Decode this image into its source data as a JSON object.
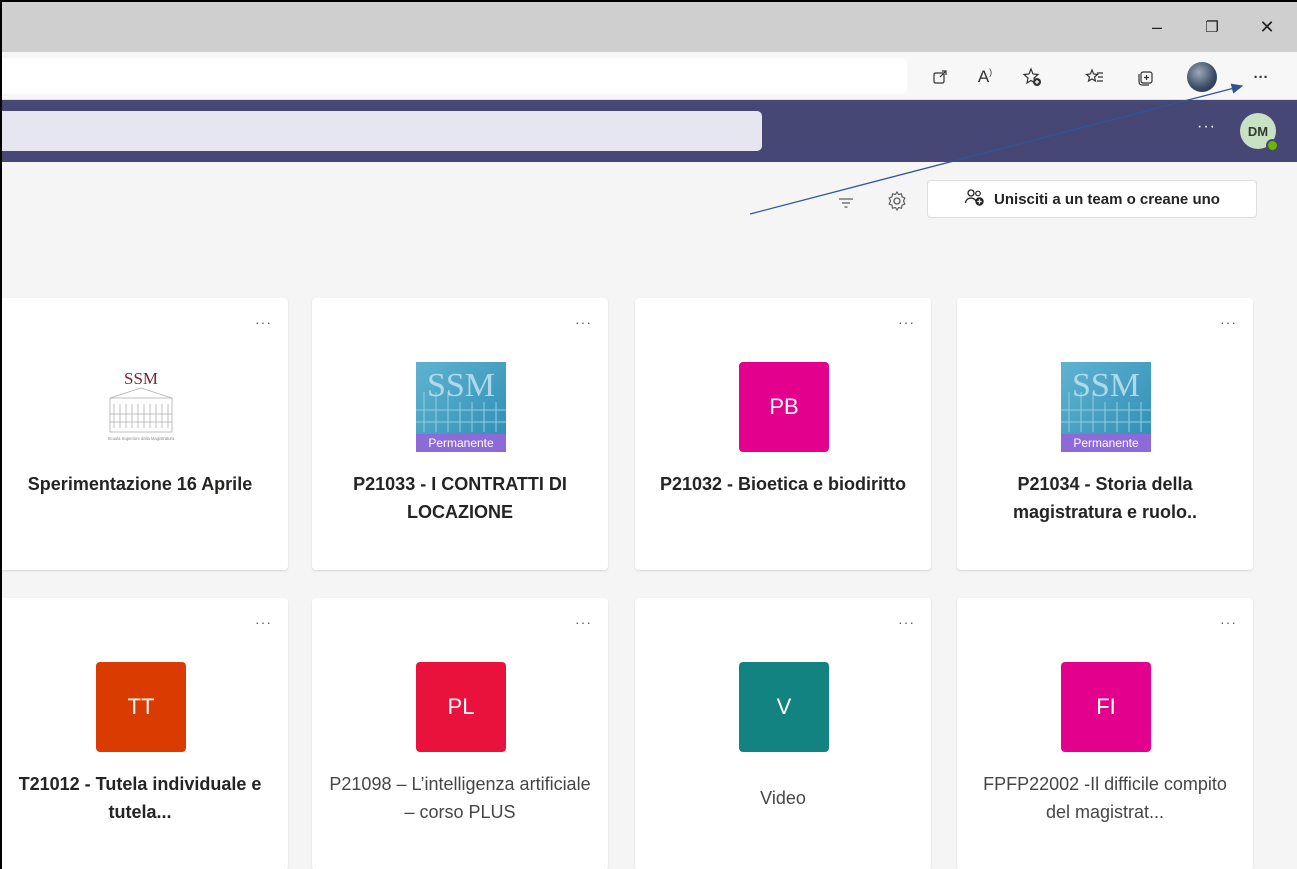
{
  "window": {
    "minimize": "–",
    "restore": "❐",
    "close": "✕"
  },
  "browser_toolbar": {
    "icons": [
      "open-external-icon",
      "read-aloud-icon",
      "add-favorite-icon",
      "favorites-icon",
      "collections-icon",
      "profile-avatar",
      "more-icon"
    ],
    "read_aloud_glyph": "A",
    "more_label": "···"
  },
  "teams_header": {
    "more_label": "···",
    "user_initials": "DM"
  },
  "toolbar": {
    "join_button_label": "Unisciti a un team o creane uno"
  },
  "cards": [
    {
      "title": "Sperimentazione 16 Aprile",
      "tile": "ssm-logo",
      "bold": true
    },
    {
      "title": "P21033 - I CONTRATTI DI LOCAZIONE",
      "tile": "ssm-permanente",
      "tile_caption": "Permanente",
      "bold": true
    },
    {
      "title": "P21032 - Bioetica e biodiritto",
      "tile_text": "PB",
      "tile_color": "#e3008c",
      "bold": true
    },
    {
      "title": "P21034 - Storia della magistratura e ruolo..",
      "tile": "ssm-permanente",
      "tile_caption": "Permanente",
      "bold": true
    },
    {
      "title": "T21012 - Tutela individuale e tutela...",
      "tile_text": "TT",
      "tile_color": "#da3b01",
      "bold": true
    },
    {
      "title": "P21098 – L’intelligenza artificiale – corso PLUS",
      "tile_text": "PL",
      "tile_color": "#e8123c",
      "bold": false
    },
    {
      "title": "Video",
      "tile_text": "V",
      "tile_color": "#138381",
      "bold": false
    },
    {
      "title": "FPFP22002 -Il difficile compito del magistrat...",
      "tile_text": "FI",
      "tile_color": "#e3008c",
      "bold": false
    }
  ],
  "ssm_logo": {
    "text": "SSM",
    "caption": "Scuola Superiore della Magistratura"
  },
  "card_more_label": "···",
  "colors": {
    "teams_purple": "#464775",
    "presence_green": "#6bb700",
    "annotation_arrow": "#2f5597"
  }
}
